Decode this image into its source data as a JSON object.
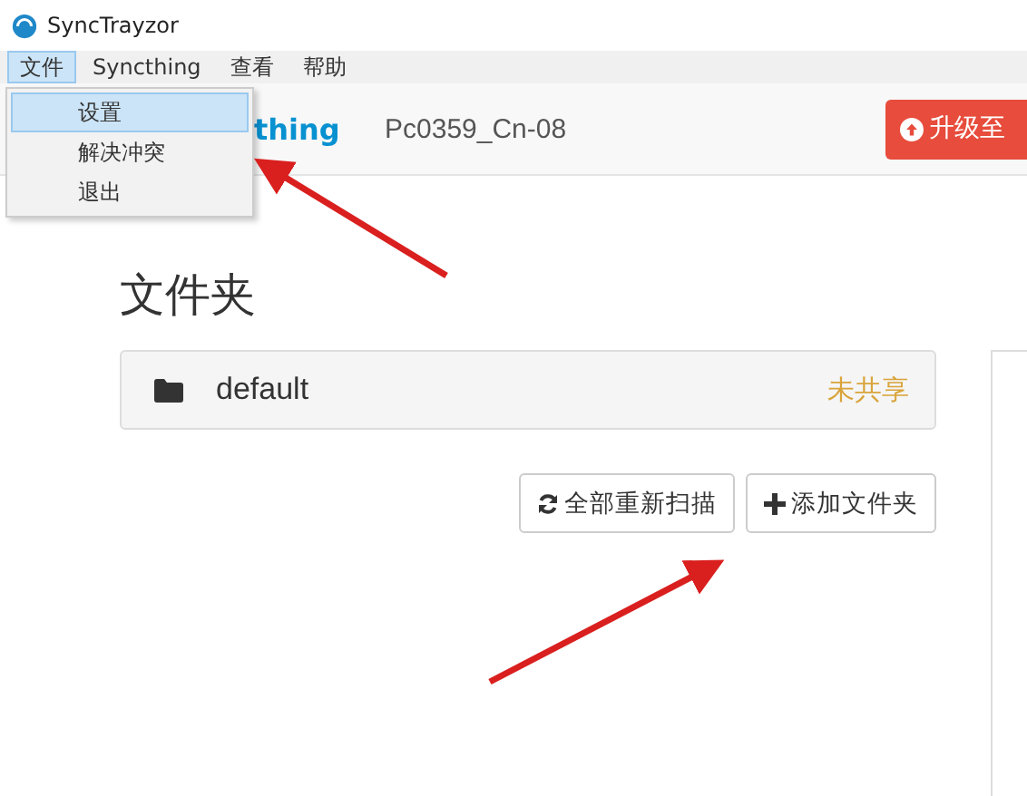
{
  "window": {
    "title": "SyncTrayzor"
  },
  "menu": [
    {
      "label": "文件",
      "selected": true
    },
    {
      "label": "Syncthing",
      "selected": false
    },
    {
      "label": "查看",
      "selected": false
    },
    {
      "label": "帮助",
      "selected": false
    }
  ],
  "dropdown": [
    {
      "label": "设置",
      "selected": true
    },
    {
      "label": "解决冲突",
      "selected": false
    },
    {
      "label": "退出",
      "selected": false
    }
  ],
  "header": {
    "brand": "thing",
    "device": "Pc0359_Cn-08",
    "upgrade_button": "升级至"
  },
  "folders": {
    "title": "文件夹",
    "items": [
      {
        "name": "default",
        "status": "未共享"
      }
    ],
    "buttons": [
      {
        "kind": "rescan",
        "label": "全部重新扫描"
      },
      {
        "kind": "add",
        "label": "添加文件夹"
      }
    ]
  }
}
